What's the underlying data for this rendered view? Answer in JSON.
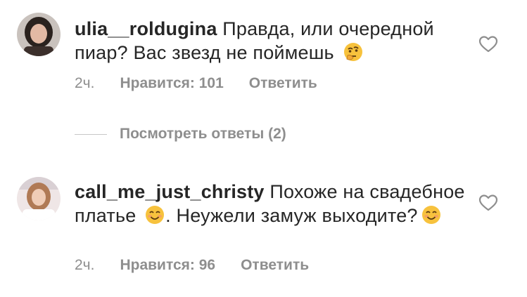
{
  "comments": [
    {
      "username": "ulia__roldugina",
      "text": " Правда, или очередной пиар? Вас звезд не поймешь ",
      "emoji": "thinking-face-emoji",
      "time": "2ч.",
      "likes": "Нравится: 101",
      "reply": "Ответить"
    },
    {
      "username": "call_me_just_christy",
      "text1": " Похоже на свадебное платье ",
      "emoji1": "smiling-face-emoji",
      "text2": ". Неужели замуж выходите?",
      "emoji2": "smiling-face-emoji",
      "time": "2ч.",
      "likes": "Нравится: 96",
      "reply": "Ответить"
    }
  ],
  "view_replies": "Посмотреть ответы (2)",
  "colors": {
    "text": "#262626",
    "meta": "#8e8e8e",
    "divider": "#c7c7c7"
  }
}
